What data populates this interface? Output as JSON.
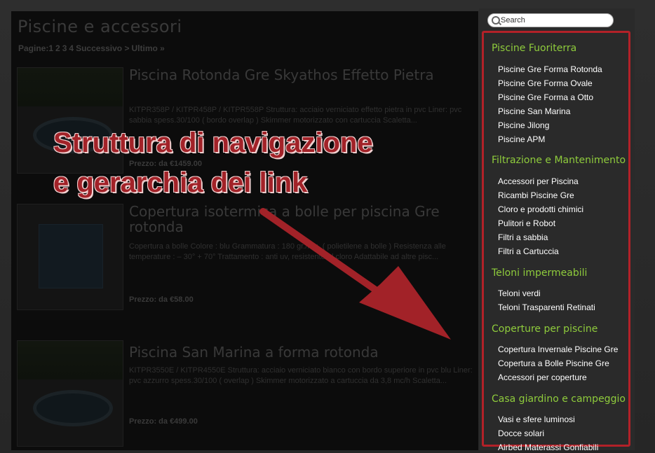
{
  "main": {
    "title": "Piscine e accessori",
    "pager": {
      "label": "Pagine:",
      "pages": [
        "1",
        "2",
        "3",
        "4"
      ],
      "next": "Successivo >",
      "last": "Ultimo »"
    },
    "products": [
      {
        "title": "Piscina Rotonda Gre Skyathos Effetto Pietra",
        "desc": "KITPR358P / KITPR458P / KITPR558P Struttura: acciaio verniciato effetto pietra in pvc Liner: pvc sabbia spess.30/100 ( bordo overlap ) Skimmer motorizzato con cartuccia Scaletta...",
        "price": "Prezzo: da €1459.00"
      },
      {
        "title": "Copertura isotermica a bolle per piscina Gre rotonda",
        "desc": "Copertura a bolle Colore : blu Grammatura : 180 gr./mq. ( polietilene a bolle ) Resistenza alle temperature : – 30° + 70° Trattamento : anti uv, resistente al cloro Adattabile ad altre pisc...",
        "price": "Prezzo: da €58.00"
      },
      {
        "title": "Piscina San Marina a forma rotonda",
        "desc": "KITPR3550E / KITPR4550E Struttura: acciaio verniciato bianco con bordo superiore in pvc blu Liner: pvc azzurro spess.30/100 ( overlap ) Skimmer motorizzato a cartuccia da 3,8 mc/h Scaletta...",
        "price": "Prezzo: da €499.00"
      }
    ]
  },
  "annotation": {
    "line1": "Struttura di navigazione",
    "line2": "e gerarchia dei link",
    "color": "#a22228"
  },
  "sidebar": {
    "search_placeholder": "Search",
    "categories": [
      {
        "title": "Piscine Fuoriterra",
        "links": [
          "Piscine Gre Forma Rotonda",
          "Piscine Gre Forma Ovale",
          "Piscine Gre Forma a Otto",
          "Piscine San Marina",
          "Piscine Jilong",
          "Piscine APM"
        ]
      },
      {
        "title": "Filtrazione e Mantenimento",
        "links": [
          "Accessori per Piscina",
          "Ricambi Piscine Gre",
          "Cloro e prodotti chimici",
          "Pulitori e Robot",
          "Filtri a sabbia",
          "Filtri a Cartuccia"
        ]
      },
      {
        "title": "Teloni impermeabili",
        "links": [
          "Teloni verdi",
          "Teloni Trasparenti Retinati"
        ]
      },
      {
        "title": "Coperture per piscine",
        "links": [
          "Copertura Invernale Piscine Gre",
          "Copertura a Bolle Piscine Gre",
          "Accessori per coperture"
        ]
      },
      {
        "title": "Casa giardino e campeggio",
        "links": [
          "Vasi e sfere luminosi",
          "Docce solari",
          "Airbed Materassi Gonfiabili"
        ]
      }
    ],
    "category_color": "#8fcc3c",
    "border_color": "#b32128"
  }
}
